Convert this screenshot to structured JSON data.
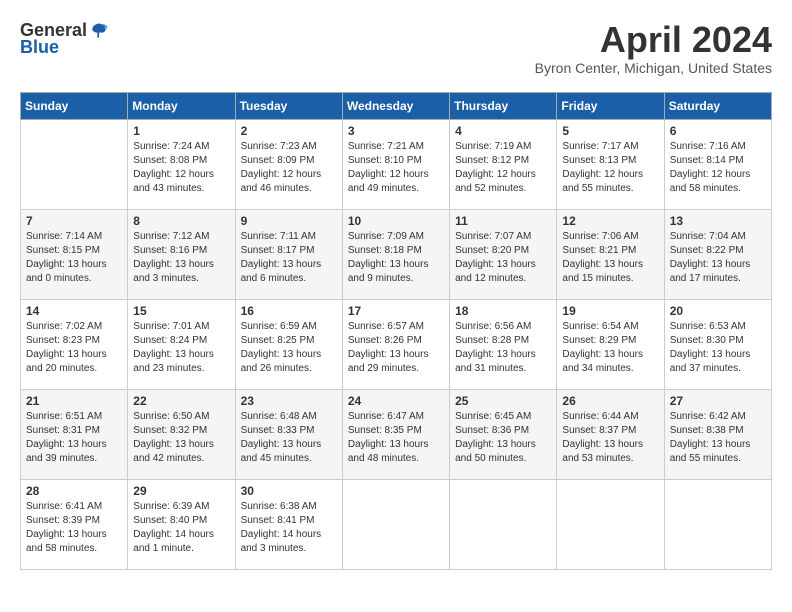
{
  "header": {
    "logo_general": "General",
    "logo_blue": "Blue",
    "month_title": "April 2024",
    "location": "Byron Center, Michigan, United States"
  },
  "days_of_week": [
    "Sunday",
    "Monday",
    "Tuesday",
    "Wednesday",
    "Thursday",
    "Friday",
    "Saturday"
  ],
  "weeks": [
    [
      {
        "day": "",
        "info": ""
      },
      {
        "day": "1",
        "info": "Sunrise: 7:24 AM\nSunset: 8:08 PM\nDaylight: 12 hours\nand 43 minutes."
      },
      {
        "day": "2",
        "info": "Sunrise: 7:23 AM\nSunset: 8:09 PM\nDaylight: 12 hours\nand 46 minutes."
      },
      {
        "day": "3",
        "info": "Sunrise: 7:21 AM\nSunset: 8:10 PM\nDaylight: 12 hours\nand 49 minutes."
      },
      {
        "day": "4",
        "info": "Sunrise: 7:19 AM\nSunset: 8:12 PM\nDaylight: 12 hours\nand 52 minutes."
      },
      {
        "day": "5",
        "info": "Sunrise: 7:17 AM\nSunset: 8:13 PM\nDaylight: 12 hours\nand 55 minutes."
      },
      {
        "day": "6",
        "info": "Sunrise: 7:16 AM\nSunset: 8:14 PM\nDaylight: 12 hours\nand 58 minutes."
      }
    ],
    [
      {
        "day": "7",
        "info": "Sunrise: 7:14 AM\nSunset: 8:15 PM\nDaylight: 13 hours\nand 0 minutes."
      },
      {
        "day": "8",
        "info": "Sunrise: 7:12 AM\nSunset: 8:16 PM\nDaylight: 13 hours\nand 3 minutes."
      },
      {
        "day": "9",
        "info": "Sunrise: 7:11 AM\nSunset: 8:17 PM\nDaylight: 13 hours\nand 6 minutes."
      },
      {
        "day": "10",
        "info": "Sunrise: 7:09 AM\nSunset: 8:18 PM\nDaylight: 13 hours\nand 9 minutes."
      },
      {
        "day": "11",
        "info": "Sunrise: 7:07 AM\nSunset: 8:20 PM\nDaylight: 13 hours\nand 12 minutes."
      },
      {
        "day": "12",
        "info": "Sunrise: 7:06 AM\nSunset: 8:21 PM\nDaylight: 13 hours\nand 15 minutes."
      },
      {
        "day": "13",
        "info": "Sunrise: 7:04 AM\nSunset: 8:22 PM\nDaylight: 13 hours\nand 17 minutes."
      }
    ],
    [
      {
        "day": "14",
        "info": "Sunrise: 7:02 AM\nSunset: 8:23 PM\nDaylight: 13 hours\nand 20 minutes."
      },
      {
        "day": "15",
        "info": "Sunrise: 7:01 AM\nSunset: 8:24 PM\nDaylight: 13 hours\nand 23 minutes."
      },
      {
        "day": "16",
        "info": "Sunrise: 6:59 AM\nSunset: 8:25 PM\nDaylight: 13 hours\nand 26 minutes."
      },
      {
        "day": "17",
        "info": "Sunrise: 6:57 AM\nSunset: 8:26 PM\nDaylight: 13 hours\nand 29 minutes."
      },
      {
        "day": "18",
        "info": "Sunrise: 6:56 AM\nSunset: 8:28 PM\nDaylight: 13 hours\nand 31 minutes."
      },
      {
        "day": "19",
        "info": "Sunrise: 6:54 AM\nSunset: 8:29 PM\nDaylight: 13 hours\nand 34 minutes."
      },
      {
        "day": "20",
        "info": "Sunrise: 6:53 AM\nSunset: 8:30 PM\nDaylight: 13 hours\nand 37 minutes."
      }
    ],
    [
      {
        "day": "21",
        "info": "Sunrise: 6:51 AM\nSunset: 8:31 PM\nDaylight: 13 hours\nand 39 minutes."
      },
      {
        "day": "22",
        "info": "Sunrise: 6:50 AM\nSunset: 8:32 PM\nDaylight: 13 hours\nand 42 minutes."
      },
      {
        "day": "23",
        "info": "Sunrise: 6:48 AM\nSunset: 8:33 PM\nDaylight: 13 hours\nand 45 minutes."
      },
      {
        "day": "24",
        "info": "Sunrise: 6:47 AM\nSunset: 8:35 PM\nDaylight: 13 hours\nand 48 minutes."
      },
      {
        "day": "25",
        "info": "Sunrise: 6:45 AM\nSunset: 8:36 PM\nDaylight: 13 hours\nand 50 minutes."
      },
      {
        "day": "26",
        "info": "Sunrise: 6:44 AM\nSunset: 8:37 PM\nDaylight: 13 hours\nand 53 minutes."
      },
      {
        "day": "27",
        "info": "Sunrise: 6:42 AM\nSunset: 8:38 PM\nDaylight: 13 hours\nand 55 minutes."
      }
    ],
    [
      {
        "day": "28",
        "info": "Sunrise: 6:41 AM\nSunset: 8:39 PM\nDaylight: 13 hours\nand 58 minutes."
      },
      {
        "day": "29",
        "info": "Sunrise: 6:39 AM\nSunset: 8:40 PM\nDaylight: 14 hours\nand 1 minute."
      },
      {
        "day": "30",
        "info": "Sunrise: 6:38 AM\nSunset: 8:41 PM\nDaylight: 14 hours\nand 3 minutes."
      },
      {
        "day": "",
        "info": ""
      },
      {
        "day": "",
        "info": ""
      },
      {
        "day": "",
        "info": ""
      },
      {
        "day": "",
        "info": ""
      }
    ]
  ]
}
